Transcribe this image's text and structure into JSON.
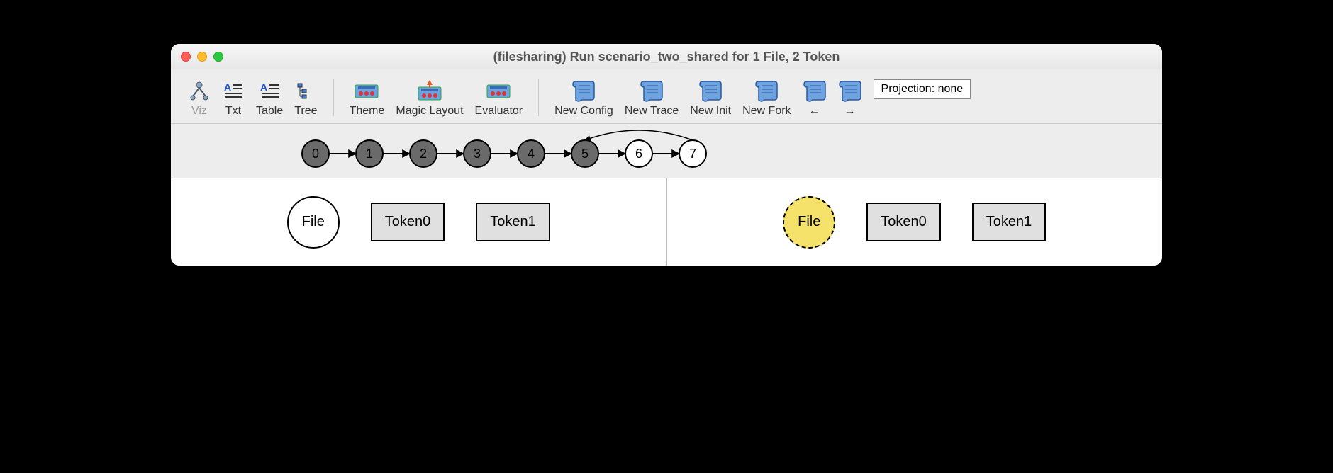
{
  "title": "(filesharing) Run scenario_two_shared for 1 File, 2 Token",
  "toolbar": {
    "viz": "Viz",
    "txt": "Txt",
    "table": "Table",
    "tree": "Tree",
    "theme": "Theme",
    "magic_layout": "Magic Layout",
    "evaluator": "Evaluator",
    "new_config": "New Config",
    "new_trace": "New Trace",
    "new_init": "New Init",
    "new_fork": "New Fork",
    "back": "←",
    "fwd": "→"
  },
  "projection_label": "Projection: none",
  "trace": {
    "nodes": [
      {
        "n": "0",
        "filled": true
      },
      {
        "n": "1",
        "filled": true
      },
      {
        "n": "2",
        "filled": true
      },
      {
        "n": "3",
        "filled": true
      },
      {
        "n": "4",
        "filled": true
      },
      {
        "n": "5",
        "filled": true
      },
      {
        "n": "6",
        "filled": false
      },
      {
        "n": "7",
        "filled": false
      }
    ],
    "loop_from": 7,
    "loop_to": 5
  },
  "panel_left": {
    "file_label": "File",
    "file_highlighted": false,
    "tokens": [
      "Token0",
      "Token1"
    ]
  },
  "panel_right": {
    "file_label": "File",
    "file_highlighted": true,
    "tokens": [
      "Token0",
      "Token1"
    ]
  }
}
